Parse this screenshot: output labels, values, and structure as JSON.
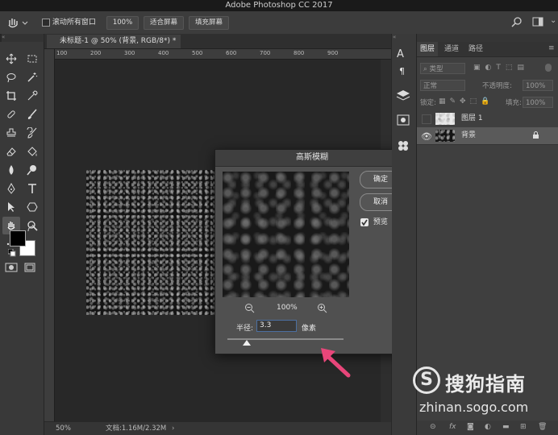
{
  "app": {
    "title": "Adobe Photoshop CC 2017"
  },
  "options_bar": {
    "scroll_all_label": "滚动所有窗口",
    "zoom_value": "100%",
    "fit_screen_label": "适合屏幕",
    "fill_screen_label": "填充屏幕"
  },
  "document": {
    "tab_title": "未标题-1 @ 50% (背景, RGB/8*) *",
    "ruler_ticks": [
      "100",
      "200",
      "300",
      "400",
      "500",
      "600",
      "700",
      "800",
      "900"
    ],
    "status": {
      "zoom": "50%",
      "doc_info": "文档:1.16M/2.32M"
    }
  },
  "dialog": {
    "title": "高斯模糊",
    "ok_label": "确定",
    "cancel_label": "取消",
    "preview_label": "预览",
    "preview_checked": true,
    "zoom_value": "100%",
    "radius_label": "半径:",
    "radius_value": "3.3",
    "unit_label": "像素"
  },
  "layers_panel": {
    "tabs": [
      "图层",
      "通道",
      "路径"
    ],
    "active_tab": "图层",
    "kind_filter": "类型",
    "blend_mode": "正常",
    "opacity_label": "不透明度:",
    "opacity_value": "100%",
    "lock_label": "锁定:",
    "fill_label": "填充:",
    "fill_value": "100%",
    "layers": [
      {
        "name": "图层 1",
        "visible": false,
        "locked": false
      },
      {
        "name": "背景",
        "visible": true,
        "locked": true,
        "selected": true
      }
    ]
  },
  "watermark": {
    "brand": "搜狗指南",
    "url": "zhinan.sogo.com"
  },
  "colors": {
    "annotation_arrow": "#e8467a",
    "selection": "#5a5a5a"
  }
}
